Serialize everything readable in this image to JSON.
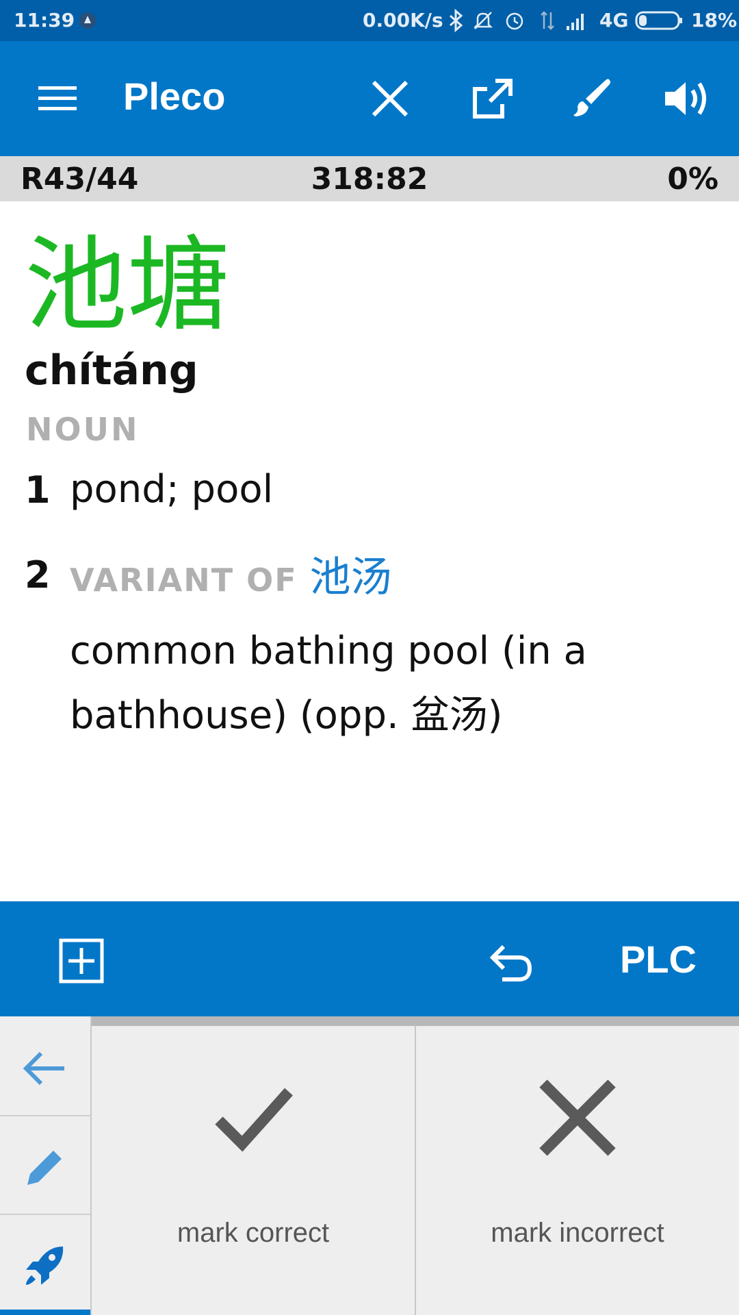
{
  "status_bar": {
    "time": "11:39",
    "net_speed": "0.00K/s",
    "network": "4G",
    "battery": "18%"
  },
  "app_bar": {
    "title": "Pleco",
    "icons": [
      "menu-icon",
      "close-icon",
      "open-external-icon",
      "brush-icon",
      "speaker-icon"
    ]
  },
  "progress": {
    "left": "R43/44",
    "center": "318:82",
    "right": "0%"
  },
  "entry": {
    "headword": "池塘",
    "pinyin": "chítáng",
    "pos": "NOUN",
    "definitions": [
      {
        "num": "1",
        "text": "pond; pool"
      },
      {
        "num": "2",
        "label": "VARIANT OF",
        "link": "池汤",
        "text": "common bathing pool (in a bathhouse) (opp. 盆汤)"
      }
    ]
  },
  "tool_bar": {
    "plc_label": "PLC"
  },
  "quiz": {
    "mark_correct": "mark correct",
    "mark_incorrect": "mark incorrect"
  },
  "colors": {
    "primary": "#0277c8",
    "status": "#005fa8",
    "headword": "#1cb824",
    "link": "#1a7fcf",
    "muted": "#b0b0b0"
  }
}
